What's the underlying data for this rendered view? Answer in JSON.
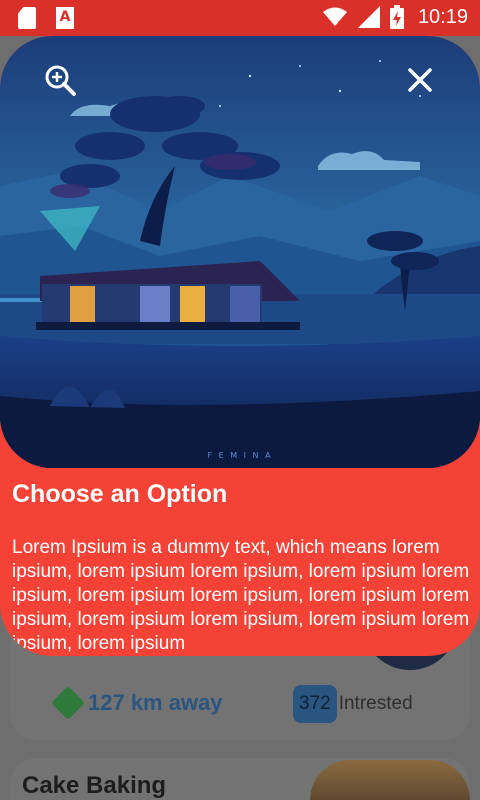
{
  "status_bar": {
    "time": "10:19",
    "app_badge": "A"
  },
  "dialog": {
    "title": "Choose an Option",
    "body": "Lorem Ipsium is a dummy text, which means lorem ipsium, lorem ipsium lorem ipsium, lorem ipsium lorem ipsium, lorem ipsium lorem ipsium, lorem ipsium lorem ipsium, lorem ipsium lorem ipsium, lorem ipsium lorem ipsium, lorem ipsium",
    "image_signature": "F E M I N A",
    "zoom_icon": "zoom-in-icon",
    "close_icon": "close-icon"
  },
  "background_list": {
    "card1": {
      "distance": "127 km away",
      "interested_count": "372",
      "interested_label": "Intrested"
    },
    "card2": {
      "title": "Cake Baking"
    }
  },
  "colors": {
    "status_bar": "#d93129",
    "dialog": "#f44336",
    "accent_blue": "#2a5580"
  }
}
